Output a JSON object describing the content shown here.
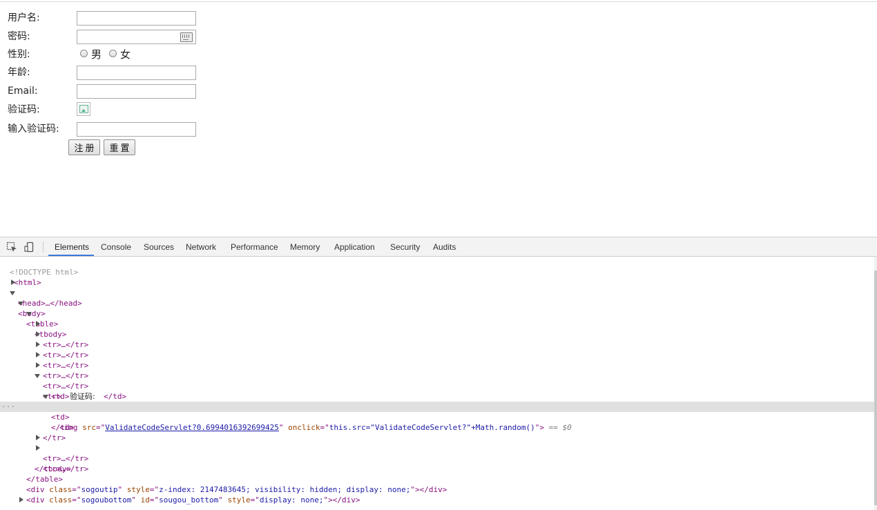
{
  "form": {
    "username_label": "用户名:",
    "password_label": "密码:",
    "gender_label": "性别:",
    "gender_male": "男",
    "gender_female": "女",
    "age_label": "年龄:",
    "email_label": "Email:",
    "captcha_label": "验证码:",
    "captcha_input_label": "输入验证码:",
    "register_button": "注册",
    "reset_button": "重置"
  },
  "devtools": {
    "tabs": [
      "Elements",
      "Console",
      "Sources",
      "Network",
      "Performance",
      "Memory",
      "Application",
      "Security",
      "Audits"
    ],
    "active_tab": "Elements",
    "tree": {
      "doctype": "<!DOCTYPE html>",
      "html_open": "<html>",
      "head": "<head>…</head>",
      "body_open": "<body>",
      "table_open": "<table>",
      "tbody_open": "<tbody>",
      "tr_collapsed": "<tr>…</tr>",
      "tr_open": "<tr>",
      "td_open": "<td>",
      "td_close": "</td>",
      "td_text": "验证码:",
      "img_src": "ValidateCodeServlet?0.6994016392699425",
      "img_onclick": "this.src=\"ValidateCodeServlet?\"+Math.random()",
      "dollar_ref": "== $0",
      "tr_close": "</tr>",
      "tbody_close": "</tbody>",
      "table_close": "</table>",
      "div1_class": "sogoutip",
      "div1_style": "z-index: 2147483645; visibility: hidden; display: none;",
      "div2_class": "sogoubottom",
      "div2_id": "sougou_bottom",
      "div2_style": "display: none;",
      "div3_id": "ext_stophi",
      "div3_style": "z-index: 2147483647;",
      "div4_id": "ext_overlay",
      "div4_class": "ext_overlayBG",
      "div4_style": "display: none; z-index: 2147483646;"
    }
  }
}
